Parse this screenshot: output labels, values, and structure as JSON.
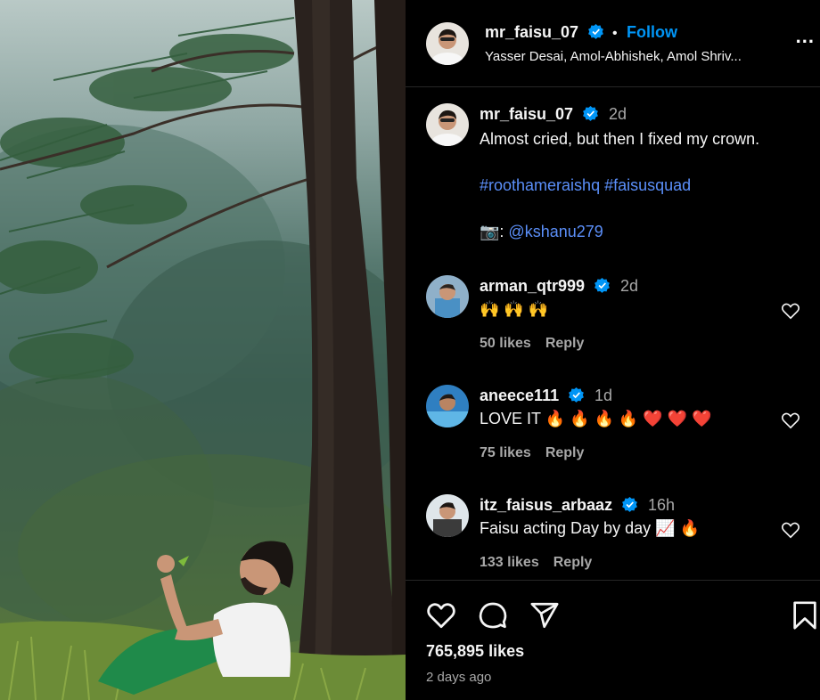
{
  "post": {
    "author": "mr_faisu_07",
    "follow_label": "Follow",
    "separator": "•",
    "collaborators": "Yasser Desai, Amol-Abhishek, Amol Shriv...",
    "more_label": "..."
  },
  "caption": {
    "username": "mr_faisu_07",
    "time": "2d",
    "text": "Almost cried, but then I fixed my crown.",
    "hashtags": "#roothameraishq #faisusquad",
    "credit_prefix": "📷: ",
    "credit_handle": "@kshanu279"
  },
  "comments": [
    {
      "username": "arman_qtr999",
      "time": "2d",
      "text": "🙌 🙌 🙌",
      "likes": "50 likes",
      "reply": "Reply"
    },
    {
      "username": "aneece111",
      "time": "1d",
      "text": "LOVE IT 🔥 🔥 🔥 🔥 ❤️ ❤️ ❤️",
      "likes": "75 likes",
      "reply": "Reply"
    },
    {
      "username": "itz_faisus_arbaaz",
      "time": "16h",
      "text": "Faisu acting Day by day 📈 🔥",
      "likes": "133 likes",
      "reply": "Reply"
    }
  ],
  "footer": {
    "likes": "765,895 likes",
    "posted": "2 days ago"
  },
  "icons": {
    "verified": "verified-badge-icon",
    "like": "heart-icon",
    "comment": "comment-icon",
    "share": "share-icon",
    "save": "bookmark-icon"
  },
  "colors": {
    "background": "#000000",
    "accent": "#0095f6",
    "link": "#5b8ff9",
    "muted": "#a8a8a8"
  }
}
